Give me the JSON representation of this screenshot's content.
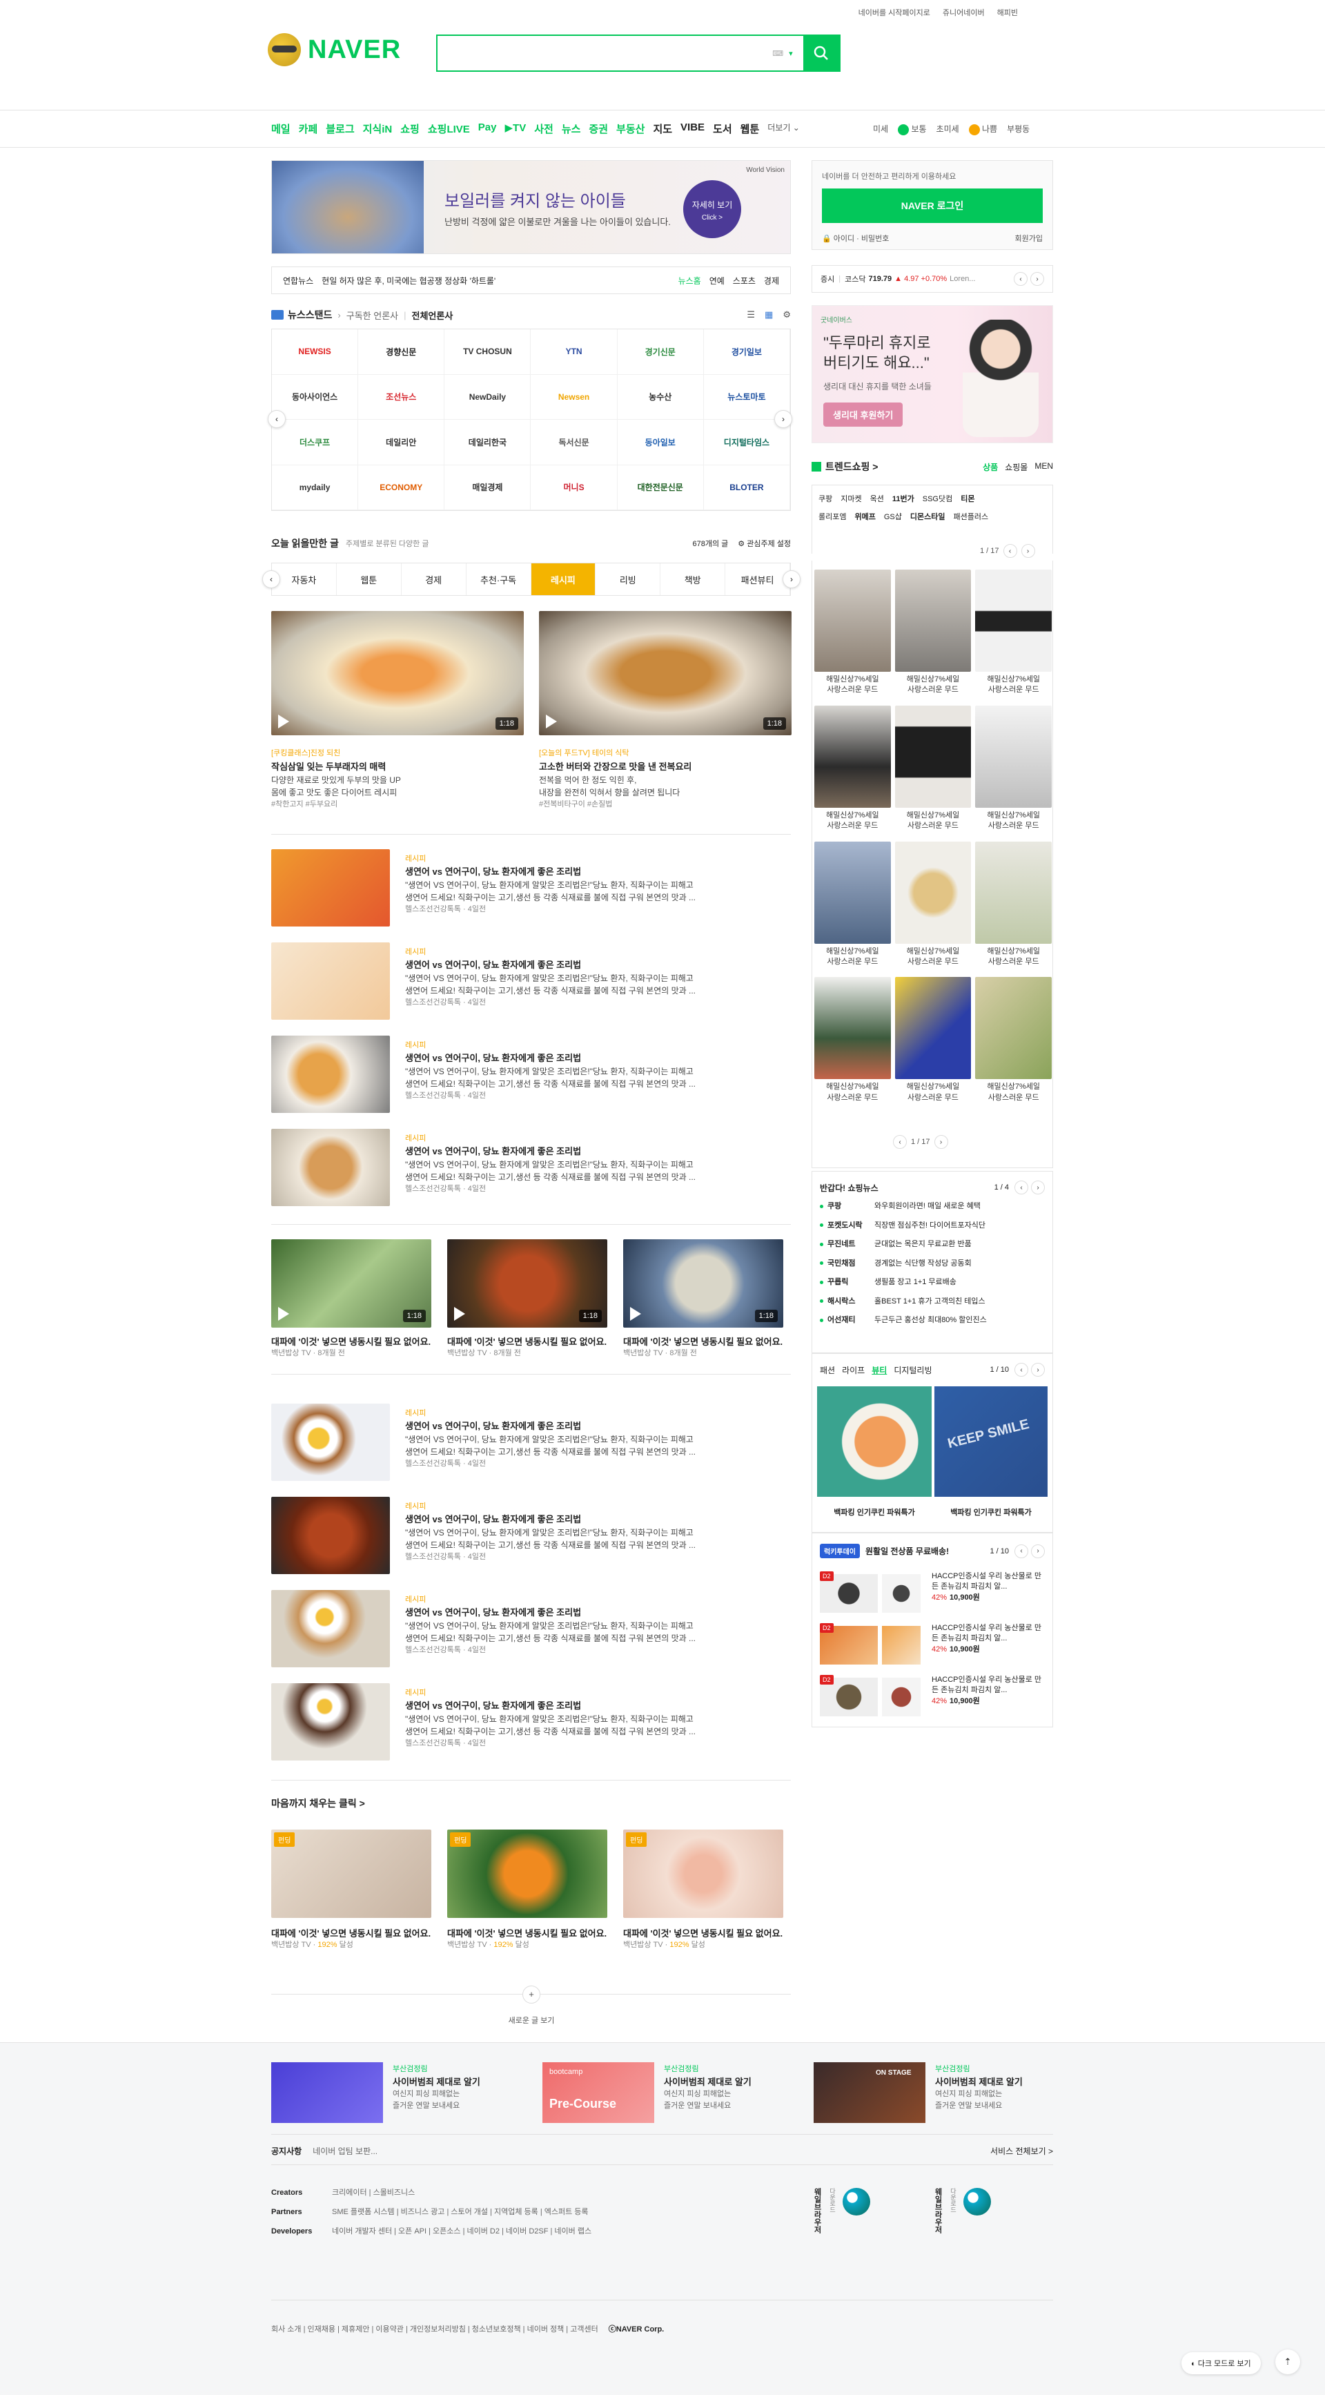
{
  "top_util": {
    "home": "네이버를 시작페이지로",
    "junior": "쥬니어네이버",
    "happybean": "해피빈"
  },
  "logo": {
    "text": "NAVER"
  },
  "search": {
    "placeholder": "",
    "kb_label": "⌨"
  },
  "nav": {
    "items": [
      "메일",
      "카페",
      "블로그",
      "지식iN",
      "쇼핑",
      "쇼핑LIVE",
      "Pay",
      "▶TV",
      "사전",
      "뉴스",
      "증권",
      "부동산",
      "지도",
      "VIBE",
      "도서",
      "웹툰",
      "더보기 ⌄"
    ],
    "weather": {
      "label": "미세",
      "status1": "보통",
      "label2": "초미세",
      "status2": "나쁨",
      "place": "부평동"
    }
  },
  "ad_banner": {
    "title": "보일러를 켜지 않는 아이들",
    "sub": "난방비 걱정에 얇은 이불로만 겨울을 나는 아이들이 있습니다.",
    "cta1": "자세히 보기",
    "cta2": "Click >",
    "brand": "World Vision"
  },
  "newsline": {
    "source": "연합뉴스",
    "headline": "현일 허자 많은 후, 미국에는 협공쟁 정상화 '하트롤'",
    "r1": "뉴스홈",
    "r2": "연예",
    "r3": "스포츠",
    "r4": "경제"
  },
  "newsstand": {
    "title": "뉴스스탠드",
    "sub1": "구독한 언론사",
    "sub2": "전체언론사"
  },
  "press": [
    "NEWSIS",
    "경향신문",
    "TV CHOSUN",
    "YTN",
    "경기신문",
    "경기일보",
    "동아사이언스",
    "조선뉴스",
    "NewDaily",
    "Newsen",
    "농수산",
    "뉴스토마토",
    "더스쿠프",
    "데일리안",
    "데일리한국",
    "독서신문",
    "동아일보",
    "디지털타임스",
    "mydaily",
    "ECONOMY",
    "매일경제",
    "머니S",
    "대한전문신문",
    "BLOTER"
  ],
  "today": {
    "title": "오늘 읽을만한 글",
    "sub": "주제별로 분류된 다양한 글",
    "count": "678개의 글",
    "setting": "관심주제 설정"
  },
  "tabs": [
    "자동차",
    "웹툰",
    "경제",
    "추천·구독",
    "레시피",
    "리빙",
    "책방",
    "패션뷰티"
  ],
  "video_cards": [
    {
      "cat": "[쿠킹클래스]진정 되친",
      "title": "작심삼일 잊는 두부래자의 매력",
      "d1": "다양한 재료로 맛있게 두부의 맛을 UP",
      "d2": "몸에 좋고 맛도 좋은 다이어트 레시피",
      "tag": "#착한고지 #두부요리",
      "dur": "1:18"
    },
    {
      "cat": "[오늘의 푸드TV] 테이의 식탁",
      "title": "고소한 버터와 간장으로 맛을 낸 전복요리",
      "d1": "전복을 먹어 한 정도 익힌 후,",
      "d2": "내장을 완전히 익혀서 향을 살려면 됩니다",
      "tag": "#전복비타구이 #손질법",
      "dur": "1:18"
    }
  ],
  "list_rows": [
    {
      "cat": "레시피",
      "title": "생연어 vs 연어구이, 당뇨 환자에게 좋은 조리법",
      "d1": "\"생연어 VS 연어구이, 당뇨 환자에게 알맞은 조리법은!\"당뇨 환자, 직화구이는 피해고",
      "d2": "생연어 드세요! 직화구이는 고기,생선 등 각종 식재료를 불에 직접 구워 본연의 맛과 ...",
      "meta": "헬스조선건강톡톡 · 4일전"
    },
    {
      "cat": "레시피",
      "title": "생연어 vs 연어구이, 당뇨 환자에게 좋은 조리법",
      "d1": "\"생연어 VS 연어구이, 당뇨 환자에게 알맞은 조리법은!\"당뇨 환자, 직화구이는 피해고",
      "d2": "생연어 드세요! 직화구이는 고기,생선 등 각종 식재료를 불에 직접 구워 본연의 맛과 ...",
      "meta": "헬스조선건강톡톡 · 4일전"
    },
    {
      "cat": "레시피",
      "title": "생연어 vs 연어구이, 당뇨 환자에게 좋은 조리법",
      "d1": "\"생연어 VS 연어구이, 당뇨 환자에게 알맞은 조리법은!\"당뇨 환자, 직화구이는 피해고",
      "d2": "생연어 드세요! 직화구이는 고기,생선 등 각종 식재료를 불에 직접 구워 본연의 맛과 ...",
      "meta": "헬스조선건강톡톡 · 4일전"
    },
    {
      "cat": "레시피",
      "title": "생연어 vs 연어구이, 당뇨 환자에게 좋은 조리법",
      "d1": "\"생연어 VS 연어구이, 당뇨 환자에게 알맞은 조리법은!\"당뇨 환자, 직화구이는 피해고",
      "d2": "생연어 드세요! 직화구이는 고기,생선 등 각종 식재료를 불에 직접 구워 본연의 맛과 ...",
      "meta": "헬스조선건강톡톡 · 4일전"
    }
  ],
  "mid_cards": [
    {
      "title": "대파에 '이것' 넣으면 냉동시킬 필요 없어요.",
      "meta": "백년밥상 TV · 8개월 전",
      "dur": "1:18"
    },
    {
      "title": "대파에 '이것' 넣으면 냉동시킬 필요 없어요.",
      "meta": "백년밥상 TV · 8개월 전",
      "dur": "1:18"
    },
    {
      "title": "대파에 '이것' 넣으면 냉동시킬 필요 없어요.",
      "meta": "백년밥상 TV · 8개월 전",
      "dur": "1:18"
    }
  ],
  "list_rows2": [
    {
      "cat": "레시피",
      "title": "생연어 vs 연어구이, 당뇨 환자에게 좋은 조리법",
      "d1": "\"생연어 VS 연어구이, 당뇨 환자에게 알맞은 조리법은!\"당뇨 환자, 직화구이는 피해고",
      "d2": "생연어 드세요! 직화구이는 고기,생선 등 각종 식재료를 불에 직접 구워 본연의 맛과 ...",
      "meta": "헬스조선건강톡톡 · 4일전"
    },
    {
      "cat": "레시피",
      "title": "생연어 vs 연어구이, 당뇨 환자에게 좋은 조리법",
      "d1": "\"생연어 VS 연어구이, 당뇨 환자에게 알맞은 조리법은!\"당뇨 환자, 직화구이는 피해고",
      "d2": "생연어 드세요! 직화구이는 고기,생선 등 각종 식재료를 불에 직접 구워 본연의 맛과 ...",
      "meta": "헬스조선건강톡톡 · 4일전"
    },
    {
      "cat": "레시피",
      "title": "생연어 vs 연어구이, 당뇨 환자에게 좋은 조리법",
      "d1": "\"생연어 VS 연어구이, 당뇨 환자에게 알맞은 조리법은!\"당뇨 환자, 직화구이는 피해고",
      "d2": "생연어 드세요! 직화구이는 고기,생선 등 각종 식재료를 불에 직접 구워 본연의 맛과 ...",
      "meta": "헬스조선건강톡톡 · 4일전"
    },
    {
      "cat": "레시피",
      "title": "생연어 vs 연어구이, 당뇨 환자에게 좋은 조리법",
      "d1": "\"생연어 VS 연어구이, 당뇨 환자에게 알맞은 조리법은!\"당뇨 환자, 직화구이는 피해고",
      "d2": "생연어 드세요! 직화구이는 고기,생선 등 각종 식재료를 불에 직접 구워 본연의 맛과 ...",
      "meta": "헬스조선건강톡톡 · 4일전"
    }
  ],
  "fill": {
    "title": "마음까지 채우는 클릭 >",
    "badge": "펀딩",
    "cards": [
      {
        "title": "대파에 '이것' 넣으면 냉동시킬 필요 없어요.",
        "meta_a": "백년밥상 TV · ",
        "pct": "192%",
        "meta_b": " 달성"
      },
      {
        "title": "대파에 '이것' 넣으면 냉동시킬 필요 없어요.",
        "meta_a": "백년밥상 TV · ",
        "pct": "192%",
        "meta_b": " 달성"
      },
      {
        "title": "대파에 '이것' 넣으면 냉동시킬 필요 없어요.",
        "meta_a": "백년밥상 TV · ",
        "pct": "192%",
        "meta_b": " 달성"
      }
    ]
  },
  "more": {
    "plus": "+",
    "label": "새로운 글 보기"
  },
  "login": {
    "msg": "네이버를 더 안전하고 편리하게 이용하세요",
    "btn": "NAVER 로그인",
    "id": "🔒 아이디 · 비밀번호",
    "join": "회원가입"
  },
  "stock": {
    "label": "증시",
    "idx": "코스닥",
    "val": "719.79",
    "chg": "▲ 4.97 +0.70%",
    "extra": "Loren..."
  },
  "ad2": {
    "brand": "굿네이버스",
    "h1": "\"두루마리 휴지로",
    "h2": "버티기도 해요...\"",
    "sub1": "생리대 대신 휴지를 택한 소녀들",
    "btn": "생리대 후원하기"
  },
  "trend": {
    "title": "트렌드쇼핑 >",
    "t1": "상품",
    "t2": "쇼핑몰",
    "t3": "MEN",
    "tags1": [
      "쿠팡",
      "지마켓",
      "옥션",
      "11번가",
      "SSG닷컴",
      "티몬"
    ],
    "tags2": [
      "롤리포엠",
      "위메프",
      "GS샵",
      "디몬스타일",
      "패션플러스"
    ],
    "page": "1 / 17"
  },
  "shop_items": [
    {
      "l1": "해밀신상7%세일",
      "l2": "사랑스러운 무드"
    },
    {
      "l1": "해밀신상7%세일",
      "l2": "사랑스러운 무드"
    },
    {
      "l1": "해밀신상7%세일",
      "l2": "사랑스러운 무드"
    },
    {
      "l1": "해밀신상7%세일",
      "l2": "사랑스러운 무드"
    },
    {
      "l1": "해밀신상7%세일",
      "l2": "사랑스러운 무드"
    },
    {
      "l1": "해밀신상7%세일",
      "l2": "사랑스러운 무드"
    },
    {
      "l1": "해밀신상7%세일",
      "l2": "사랑스러운 무드"
    },
    {
      "l1": "해밀신상7%세일",
      "l2": "사랑스러운 무드"
    },
    {
      "l1": "해밀신상7%세일",
      "l2": "사랑스러운 무드"
    },
    {
      "l1": "해밀신상7%세일",
      "l2": "사랑스러운 무드"
    },
    {
      "l1": "해밀신상7%세일",
      "l2": "사랑스러운 무드"
    },
    {
      "l1": "해밀신상7%세일",
      "l2": "사랑스러운 무드"
    }
  ],
  "shop_page": "1 / 17",
  "shopnews": {
    "title": "반갑다! 쇼핑뉴스",
    "page": "1 / 4",
    "items": [
      {
        "src": "쿠팡",
        "txt": "와우회원이라면! 매일 새로운 혜택"
      },
      {
        "src": "포켓도시락",
        "txt": "직장맨 점심주천! 다이어트포자식단"
      },
      {
        "src": "무진네트",
        "txt": "균대없는 목은지 무료교환 반품"
      },
      {
        "src": "국민채점",
        "txt": "경계없는 식단행 작성당 공동회"
      },
      {
        "src": "꾸릅릭",
        "txt": "생필품 장고 1+1 무료배송"
      },
      {
        "src": "해시락스",
        "txt": "홀BEST 1+1 휴가 고객의친 테입스"
      },
      {
        "src": "어선재티",
        "txt": "두근두근 홍선상 최대80% 할인진스"
      }
    ]
  },
  "life": {
    "tabs": [
      "패션",
      "라이프",
      "뷰티",
      "디지털리빙"
    ],
    "page": "1 / 10",
    "items": [
      {
        "title": "백파킹 인기쿠킨 파워특가"
      },
      {
        "title": "백파킹 인기쿠킨 파워특가"
      }
    ]
  },
  "deal": {
    "badge": "럭키투데이",
    "title": "원활일 전상품 무료배송!",
    "page": "1 / 10",
    "items": [
      {
        "tag": "D2",
        "name": "HACCP인증시설 우리 농산물로 만든 존뉴김치 파김치 알...",
        "pct": "42%",
        "price": "10,900원"
      },
      {
        "tag": "D2",
        "name": "HACCP인증시설 우리 농산물로 만든 존뉴김치 파김치 알...",
        "pct": "42%",
        "price": "10,900원"
      },
      {
        "tag": "D2",
        "name": "HACCP인증시설 우리 농산물로 만든 존뉴김치 파김치 알...",
        "pct": "42%",
        "price": "10,900원"
      }
    ]
  },
  "footer": {
    "promos": [
      {
        "tag": "부산검정림",
        "title": "사이버범죄 제대로 알기",
        "d1": "여신지 피싱 피해없는",
        "d2": "즐거운 연말 보내세요"
      },
      {
        "tag": "부산검정림",
        "title": "사이버범죄 제대로 알기",
        "d1": "여신지 피싱 피해없는",
        "d2": "즐거운 연말 보내세요"
      },
      {
        "tag": "부산검정림",
        "title": "사이버범죄 제대로 알기",
        "d1": "여신지 피싱 피해없는",
        "d2": "즐거운 연말 보내세요"
      }
    ],
    "promo_img2": "Pre-Course",
    "promo_img2_top": "bootcamp",
    "promo_img3": "ON STAGE",
    "notice": {
      "label": "공지사항",
      "txt": "네이버 업팀 보판...",
      "all": "서비스 전체보기 >"
    },
    "creators": {
      "label": "Creators",
      "links": "크리에이터 | 스몰비즈니스"
    },
    "partners": {
      "label": "Partners",
      "links": "SME 플랫폼 시스템 | 비즈니스 광고 | 스토어 개설 | 지역업체 등록 | 엑스퍼트 등록"
    },
    "developers": {
      "label": "Developers",
      "links": "네이버 개발자 센터 | 오픈 API | 오픈소스 | 네이버 D2 | 네이버 D2SF | 네이버 랩스"
    },
    "apps": [
      {
        "v": "웨일브라우저",
        "s": "다운로드"
      },
      {
        "v": "웨일브라우저",
        "s": "다운로드"
      }
    ],
    "bottom": "회사 소개 | 인재채용 | 제휴제안 | 이용약관 | 개인정보처리방침 | 청소년보호정책 | 네이버 정책 | 고객센터",
    "corp": "ⓒNAVER Corp.",
    "dark": "◐ 다크 모드로 보기",
    "top": "⇡"
  }
}
